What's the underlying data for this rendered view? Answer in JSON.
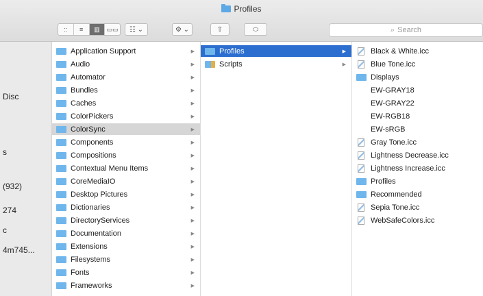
{
  "window": {
    "title": "Profiles"
  },
  "toolbar": {
    "view_icons": [
      "::",
      "≡",
      "▥",
      "▭▭"
    ],
    "group_label": "☷ ⌄",
    "action_label": "⚙ ⌄",
    "share_label": "⇧",
    "tags_label": "⬭",
    "search_placeholder": "Search"
  },
  "sidebar": {
    "items": [
      "Disc",
      "s",
      "(932)",
      "274",
      "c",
      "4m745..."
    ]
  },
  "column1": {
    "items": [
      "Application Support",
      "Audio",
      "Automator",
      "Bundles",
      "Caches",
      "ColorPickers",
      "ColorSync",
      "Components",
      "Compositions",
      "Contextual Menu Items",
      "CoreMediaIO",
      "Desktop Pictures",
      "Dictionaries",
      "DirectoryServices",
      "Documentation",
      "Extensions",
      "Filesystems",
      "Fonts",
      "Frameworks"
    ],
    "selected": "ColorSync"
  },
  "column2": {
    "items": [
      "Profiles",
      "Scripts"
    ],
    "selected": "Profiles"
  },
  "column3": {
    "items": [
      "Black & White.icc",
      "Blue Tone.icc",
      "Displays",
      "EW-GRAY18",
      "EW-GRAY22",
      "EW-RGB18",
      "EW-sRGB",
      "Gray Tone.icc",
      "Lightness Decrease.icc",
      "Lightness Increase.icc",
      "Profiles",
      "Recommended",
      "Sepia Tone.icc",
      "WebSafeColors.icc"
    ]
  }
}
